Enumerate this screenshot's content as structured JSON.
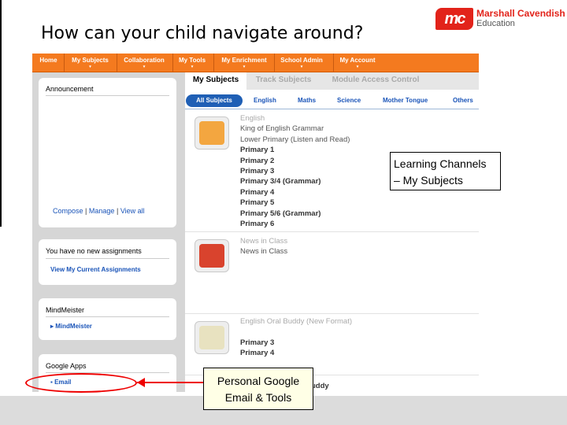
{
  "slide": {
    "title": "How can your child navigate around?"
  },
  "logo": {
    "mark": "mc",
    "name": "Marshall Cavendish",
    "sub": "Education",
    "color": "#e2231a"
  },
  "nav": {
    "items": [
      "Home",
      "My Subjects",
      "Collaboration",
      "My Tools",
      "My Enrichment",
      "School Admin",
      "My Account"
    ],
    "color": "#f47a1f"
  },
  "sidebar": {
    "announcement": {
      "title": "Announcement",
      "compose": "Compose",
      "manage": "Manage",
      "view_all": "View all",
      "sep": "|"
    },
    "assignments": {
      "title": "You have no new assignments",
      "link": "View My Current Assignments"
    },
    "mindmeister": {
      "title": "MindMeister",
      "link": "MindMeister"
    },
    "google": {
      "title": "Google Apps",
      "link": "Email"
    }
  },
  "main": {
    "tabs": [
      "My Subjects",
      "Track Subjects",
      "Module Access Control"
    ],
    "subjects": [
      "All Subjects",
      "English",
      "Maths",
      "Science",
      "Mother Tongue",
      "Others"
    ],
    "entries": [
      {
        "icon": "grammar-game-icon",
        "lines": [
          "English",
          "King of English Grammar",
          "Lower Primary (Listen and Read)",
          "Primary 1",
          "Primary 2",
          "Primary 3",
          "Primary 3/4 (Grammar)",
          "Primary 4",
          "Primary 5",
          "Primary 5/6 (Grammar)",
          "Primary 6"
        ]
      },
      {
        "icon": "news-in-class-icon",
        "lines": [
          "News in Class",
          "News in Class"
        ]
      },
      {
        "icon": "oral-buddy-icon",
        "lines": [
          "English Oral Buddy (New Format)",
          "",
          "Primary 3",
          "Primary 4"
        ]
      },
      {
        "icon": "oral-buddy-icon",
        "lines": [
          "",
          "",
          "uddy"
        ]
      }
    ]
  },
  "callouts": {
    "learning_channels": [
      "Learning Channels",
      "– My Subjects"
    ],
    "personal_google": [
      "Personal Google",
      "Email & Tools"
    ]
  }
}
